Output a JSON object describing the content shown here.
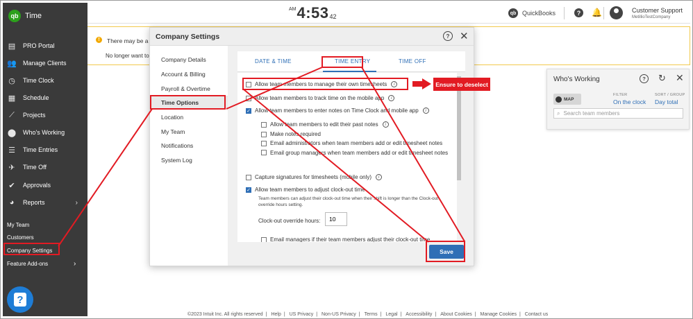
{
  "sidebar": {
    "app_name": "Time",
    "logo_text": "qb",
    "items": [
      {
        "label": "PRO Portal",
        "icon": "pro-portal-icon",
        "glyph": "▤"
      },
      {
        "label": "Manage Clients",
        "icon": "clients-icon",
        "glyph": "👥"
      },
      {
        "label": "Time Clock",
        "icon": "clock-icon",
        "glyph": "◷"
      },
      {
        "label": "Schedule",
        "icon": "calendar-icon",
        "glyph": "▦"
      },
      {
        "label": "Projects",
        "icon": "projects-icon",
        "glyph": "⟋"
      },
      {
        "label": "Who's Working",
        "icon": "location-pin-icon",
        "glyph": "⬤"
      },
      {
        "label": "Time Entries",
        "icon": "time-entries-icon",
        "glyph": "☰"
      },
      {
        "label": "Time Off",
        "icon": "plane-icon",
        "glyph": "✈"
      },
      {
        "label": "Approvals",
        "icon": "checkmark-icon",
        "glyph": "✔"
      },
      {
        "label": "Reports",
        "icon": "pie-chart-icon",
        "glyph": "◕"
      }
    ],
    "sub_items": [
      "My Team",
      "Customers",
      "Company Settings",
      "Feature Add-ons"
    ],
    "help_glyph": "?"
  },
  "topbar": {
    "clock_ampm": "AM",
    "clock_time": "4:53",
    "clock_seconds": "42",
    "quickbooks_label": "QuickBooks",
    "user_name": "Customer Support",
    "user_company": "MetillioTestCompany"
  },
  "alert": {
    "line1": "There may be a",
    "line2": "No longer want to"
  },
  "modal": {
    "title": "Company Settings",
    "nav": [
      "Company Details",
      "Account & Billing",
      "Payroll & Overtime",
      "Time Options",
      "Location",
      "My Team",
      "Notifications",
      "System Log"
    ],
    "active_nav": "Time Options",
    "tabs": [
      "DATE & TIME",
      "TIME ENTRY",
      "TIME OFF"
    ],
    "active_tab": "TIME ENTRY",
    "options": [
      {
        "label": "Allow team members to manage their own timesheets",
        "checked": false
      },
      {
        "label": "Allow team members to track time on the mobile app",
        "checked": false
      },
      {
        "label": "Allow team members to enter notes on Time Clock and mobile app",
        "checked": true
      },
      {
        "label": "Allow team members to edit their past notes",
        "checked": false
      },
      {
        "label": "Make notes required",
        "checked": false
      },
      {
        "label": "Email administrators when team members add or edit timesheet notes",
        "checked": false
      },
      {
        "label": "Email group managers when team members add or edit timesheet notes",
        "checked": false
      },
      {
        "label": "Capture signatures for timesheets (mobile only)",
        "checked": false
      },
      {
        "label": "Allow team members to adjust clock-out time",
        "checked": true
      },
      {
        "label": "Email managers if their team members adjust their clock-out time",
        "checked": false
      }
    ],
    "clockout_description": "Team members can adjust their clock-out time when their shift is longer than the Clock-out override hours setting.",
    "override_label": "Clock-out override hours:",
    "override_value": "10",
    "save_label": "Save"
  },
  "whos_working": {
    "title": "Who's Working",
    "map_label": "MAP",
    "filter_label": "FILTER",
    "filter_value": "On the clock",
    "sort_label": "SORT / GROUP",
    "sort_value": "Day total",
    "search_placeholder": "Search team members"
  },
  "annotation": {
    "callout_text": "Ensure to deselect",
    "color": "#e21b23"
  },
  "footer": [
    "©2023 Intuit Inc. All rights reserved",
    "Help",
    "US Privacy",
    "Non-US Privacy",
    "Terms",
    "Legal",
    "Accessibility",
    "About Cookies",
    "Manage Cookies",
    "Contact us"
  ],
  "colors": {
    "sidebar_bg": "#3a3a3a",
    "accent_blue": "#2f6fb6",
    "brand_green": "#2ca01c",
    "alert_border": "#f2c94c"
  }
}
